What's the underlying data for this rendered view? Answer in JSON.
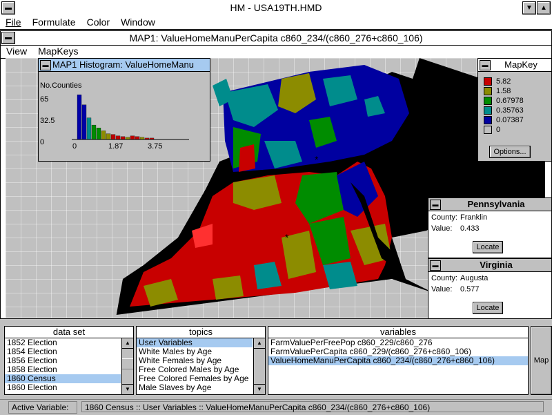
{
  "app": {
    "title": "HM - USA19TH.HMD"
  },
  "menu": {
    "file": "File",
    "formulate": "Formulate",
    "color": "Color",
    "window": "Window"
  },
  "map_window": {
    "title": "MAP1: ValueHomeManuPerCapita c860_234/(c860_276+c860_106)",
    "menu": {
      "view": "View",
      "mapkeys": "MapKeys"
    }
  },
  "histogram": {
    "title": "MAP1 Histogram: ValueHomeManu",
    "ylabel": "No.Counties",
    "yticks": [
      "65",
      "32.5",
      "0"
    ],
    "xticks": [
      "0",
      "1.87",
      "3.75"
    ]
  },
  "chart_data": {
    "type": "bar",
    "title": "MAP1 Histogram: ValueHomeManu",
    "ylabel": "No.Counties",
    "ylim": [
      0,
      65
    ],
    "xlim": [
      0,
      3.75
    ],
    "values": [
      62,
      48,
      30,
      20,
      16,
      12,
      8,
      7,
      5,
      4,
      3,
      5,
      4,
      3,
      2,
      2
    ],
    "colors": [
      "#0000a8",
      "#0000a8",
      "#008c8c",
      "#008c00",
      "#008c00",
      "#8c8c00",
      "#8c8c00",
      "#c00000",
      "#c00000",
      "#c00000",
      "#8c8c00",
      "#c00000",
      "#c00000",
      "#8c8c00",
      "#c00000",
      "#c00000"
    ]
  },
  "mapkey": {
    "title": "MapKey",
    "entries": [
      {
        "label": "5.82",
        "color": "#c80000"
      },
      {
        "label": "1.58",
        "color": "#8c8c00"
      },
      {
        "label": "0.67978",
        "color": "#008c00"
      },
      {
        "label": "0.35763",
        "color": "#008c8c"
      },
      {
        "label": "0.07387",
        "color": "#0000a0"
      },
      {
        "label": "0",
        "color": "#c0c0c0"
      }
    ],
    "options_label": "Options..."
  },
  "pennsylvania": {
    "title": "Pennsylvania",
    "county_label": "County:",
    "county": "Franklin",
    "value_label": "Value:",
    "value": "0.433",
    "locate_label": "Locate"
  },
  "virginia": {
    "title": "Virginia",
    "county_label": "County:",
    "county": "Augusta",
    "value_label": "Value:",
    "value": "0.577",
    "locate_label": "Locate"
  },
  "dataset": {
    "header": "data set",
    "items": [
      "1852 Election",
      "1854 Election",
      "1856 Election",
      "1858 Election",
      "1860 Census",
      "1860 Election"
    ],
    "selected": 4
  },
  "topics": {
    "header": "topics",
    "items": [
      "User Variables",
      "White Males by Age",
      "White Females by Age",
      "Free Colored Males by Age",
      "Free Colored Females by Age",
      "Male Slaves by Age"
    ],
    "selected": 0
  },
  "variables": {
    "header": "variables",
    "items": [
      "FarmValuePerFreePop c860_229/c860_276",
      "FarmValuePerCapita c860_229/(c860_276+c860_106)",
      "ValueHomeManuPerCapita c860_234/(c860_276+c860_106)"
    ],
    "selected": 2
  },
  "map_button": {
    "label": "Map"
  },
  "status": {
    "label": "Active Variable:",
    "value": "1860 Census :: User Variables :: ValueHomeManuPerCapita c860_234/(c860_276+c860_106)"
  }
}
